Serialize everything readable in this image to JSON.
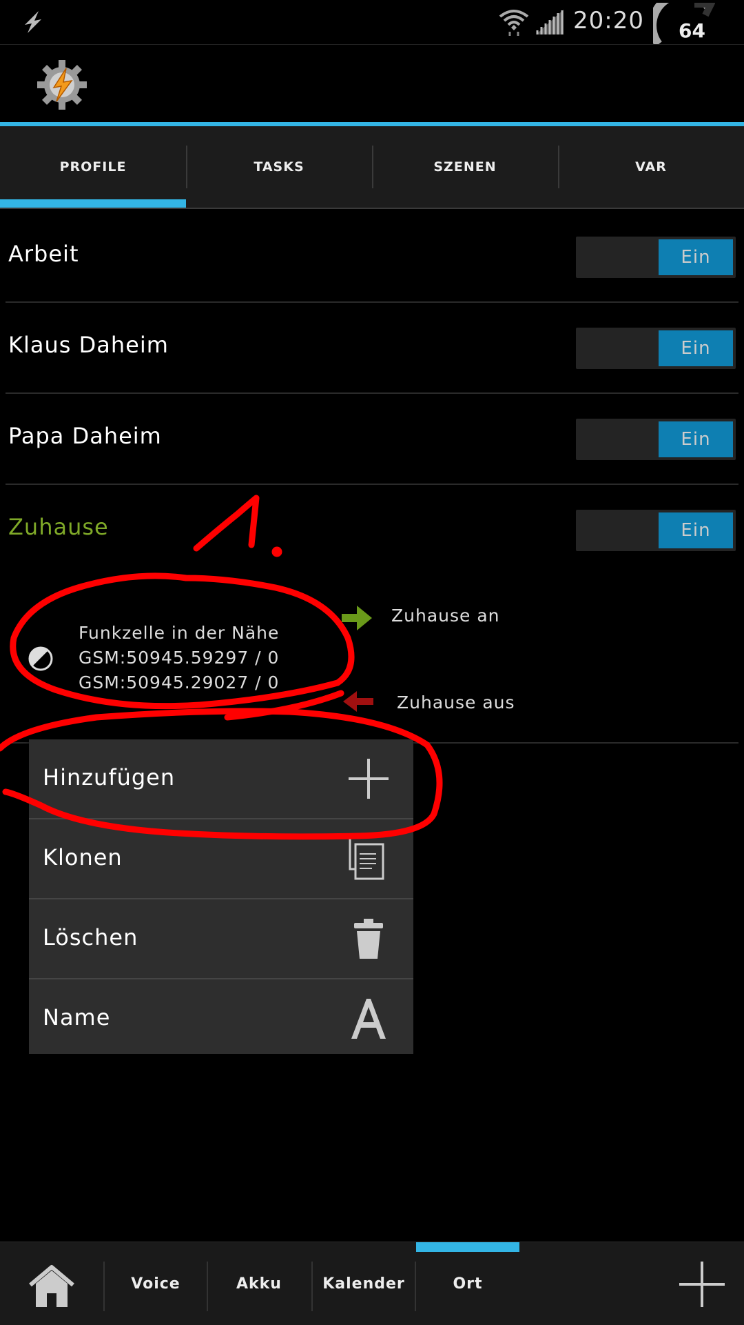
{
  "status_bar": {
    "time": "20:20",
    "battery": "64"
  },
  "tabs": [
    {
      "label": "PROFILE",
      "active": true
    },
    {
      "label": "TASKS",
      "active": false
    },
    {
      "label": "SZENEN",
      "active": false
    },
    {
      "label": "VAR",
      "active": false
    }
  ],
  "profiles": [
    {
      "name": "Arbeit",
      "toggle": "Ein"
    },
    {
      "name": "Klaus Daheim",
      "toggle": "Ein"
    },
    {
      "name": "Papa Daheim",
      "toggle": "Ein"
    },
    {
      "name": "Zuhause",
      "toggle": "Ein"
    }
  ],
  "context": {
    "lines": [
      "Funkzelle in der Nähe",
      "GSM:50945.59297 / 0",
      "GSM:50945.29027 / 0"
    ],
    "enter_task": "Zuhause an",
    "exit_task": "Zuhause aus"
  },
  "menu": [
    {
      "label": "Hinzufügen",
      "icon": "plus-icon"
    },
    {
      "label": "Klonen",
      "icon": "clone-icon"
    },
    {
      "label": "Löschen",
      "icon": "trash-icon"
    },
    {
      "label": "Name",
      "icon": "letter-a-icon"
    }
  ],
  "annotation": {
    "number": "1"
  },
  "bottom_bar": {
    "items": [
      "Voice",
      "Akku",
      "Kalender",
      "Ort"
    ],
    "active": "Ort"
  },
  "colors": {
    "accent": "#33b5e5",
    "toggle_on": "#0e7fb2",
    "active_profile": "#7fa928",
    "annotation": "#ff0000"
  }
}
